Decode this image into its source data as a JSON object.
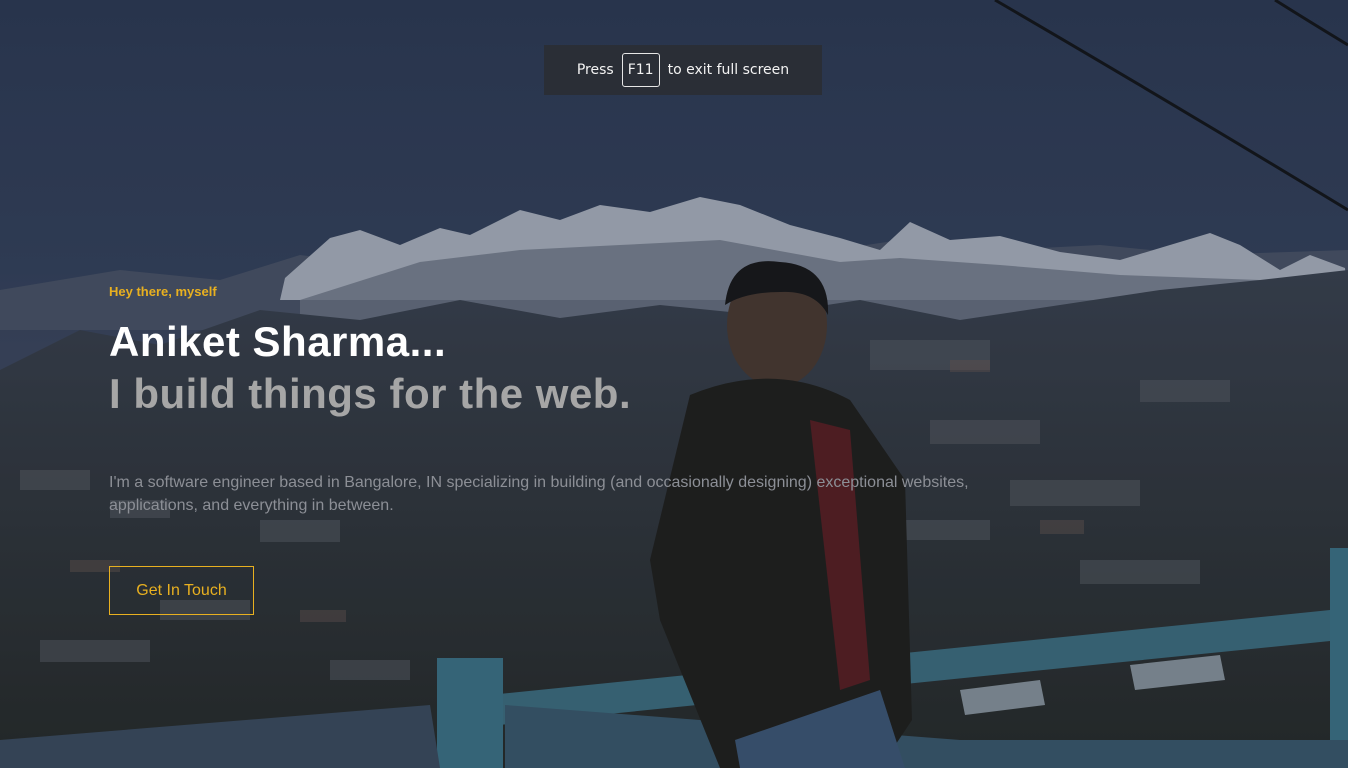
{
  "fullscreen_notice": {
    "prefix": "Press",
    "key": "F11",
    "suffix": "to exit full screen"
  },
  "hero": {
    "greeting": "Hey there, myself",
    "name": "Aniket Sharma...",
    "tagline": "I build things for the web.",
    "description": "I'm a software engineer based in Bangalore, IN specializing in building (and occasionally designing) exceptional websites, applications, and everything in between.",
    "cta_label": "Get In Touch"
  },
  "colors": {
    "accent": "#e8b020",
    "name": "#ffffff",
    "tagline": "#a6a6a6",
    "description": "#8c8f96"
  },
  "background_image": "mountain-town-portrait-photo"
}
